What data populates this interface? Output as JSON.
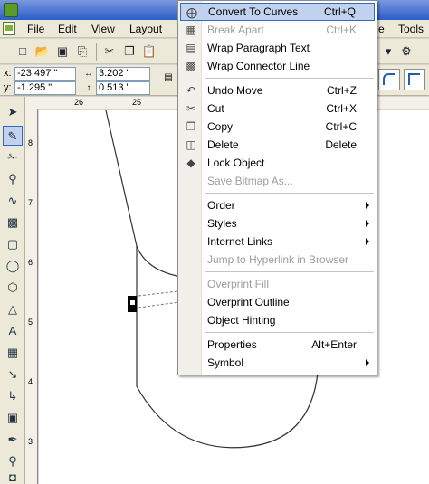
{
  "menubar": {
    "items": [
      "File",
      "Edit",
      "View",
      "Layout",
      "e",
      "Tools"
    ]
  },
  "propbar": {
    "x_label": "x:",
    "y_label": "y:",
    "x_value": "-23.497 \"",
    "y_value": "-1.295 \"",
    "w_value": "3.202 \"",
    "h_value": "0.513 \""
  },
  "ruler": {
    "h_numbers": [
      "26",
      "25"
    ],
    "v_numbers": [
      "8",
      "7",
      "6",
      "5",
      "4",
      "3"
    ]
  },
  "context_menu": {
    "items": [
      {
        "label": "Convert To Curves",
        "shortcut": "Ctrl+Q",
        "disabled": false,
        "icon": "convert-curves-icon"
      },
      {
        "label": "Break Apart",
        "shortcut": "Ctrl+K",
        "disabled": true,
        "icon": "break-apart-icon"
      },
      {
        "label": "Wrap Paragraph Text",
        "shortcut": "",
        "disabled": false,
        "icon": "wrap-text-icon"
      },
      {
        "label": "Wrap Connector Line",
        "shortcut": "",
        "disabled": false,
        "icon": "wrap-connector-icon"
      },
      {
        "label": "Undo Move",
        "shortcut": "Ctrl+Z",
        "disabled": false,
        "icon": "undo-icon"
      },
      {
        "label": "Cut",
        "shortcut": "Ctrl+X",
        "disabled": false,
        "icon": "scissors-icon"
      },
      {
        "label": "Copy",
        "shortcut": "Ctrl+C",
        "disabled": false,
        "icon": "copy-icon"
      },
      {
        "label": "Delete",
        "shortcut": "Delete",
        "disabled": false,
        "icon": "trash-icon"
      },
      {
        "label": "Lock Object",
        "shortcut": "",
        "disabled": false,
        "icon": "lock-icon"
      },
      {
        "label": "Save Bitmap As...",
        "shortcut": "",
        "disabled": true,
        "icon": ""
      },
      {
        "label": "Order",
        "shortcut": "",
        "disabled": false,
        "submenu": true
      },
      {
        "label": "Styles",
        "shortcut": "",
        "disabled": false,
        "submenu": true
      },
      {
        "label": "Internet Links",
        "shortcut": "",
        "disabled": false,
        "submenu": true
      },
      {
        "label": "Jump to Hyperlink in Browser",
        "shortcut": "",
        "disabled": true
      },
      {
        "label": "Overprint Fill",
        "shortcut": "",
        "disabled": true
      },
      {
        "label": "Overprint Outline",
        "shortcut": "",
        "disabled": false
      },
      {
        "label": "Object Hinting",
        "shortcut": "",
        "disabled": false
      },
      {
        "label": "Properties",
        "shortcut": "Alt+Enter",
        "disabled": false
      },
      {
        "label": "Symbol",
        "shortcut": "",
        "disabled": false,
        "submenu": true
      }
    ]
  },
  "colors": {
    "menu_highlight": "#c1d2ee",
    "menu_highlight_border": "#316ac5",
    "disabled_text": "#9d9d9d",
    "chrome": "#ece9d8"
  }
}
